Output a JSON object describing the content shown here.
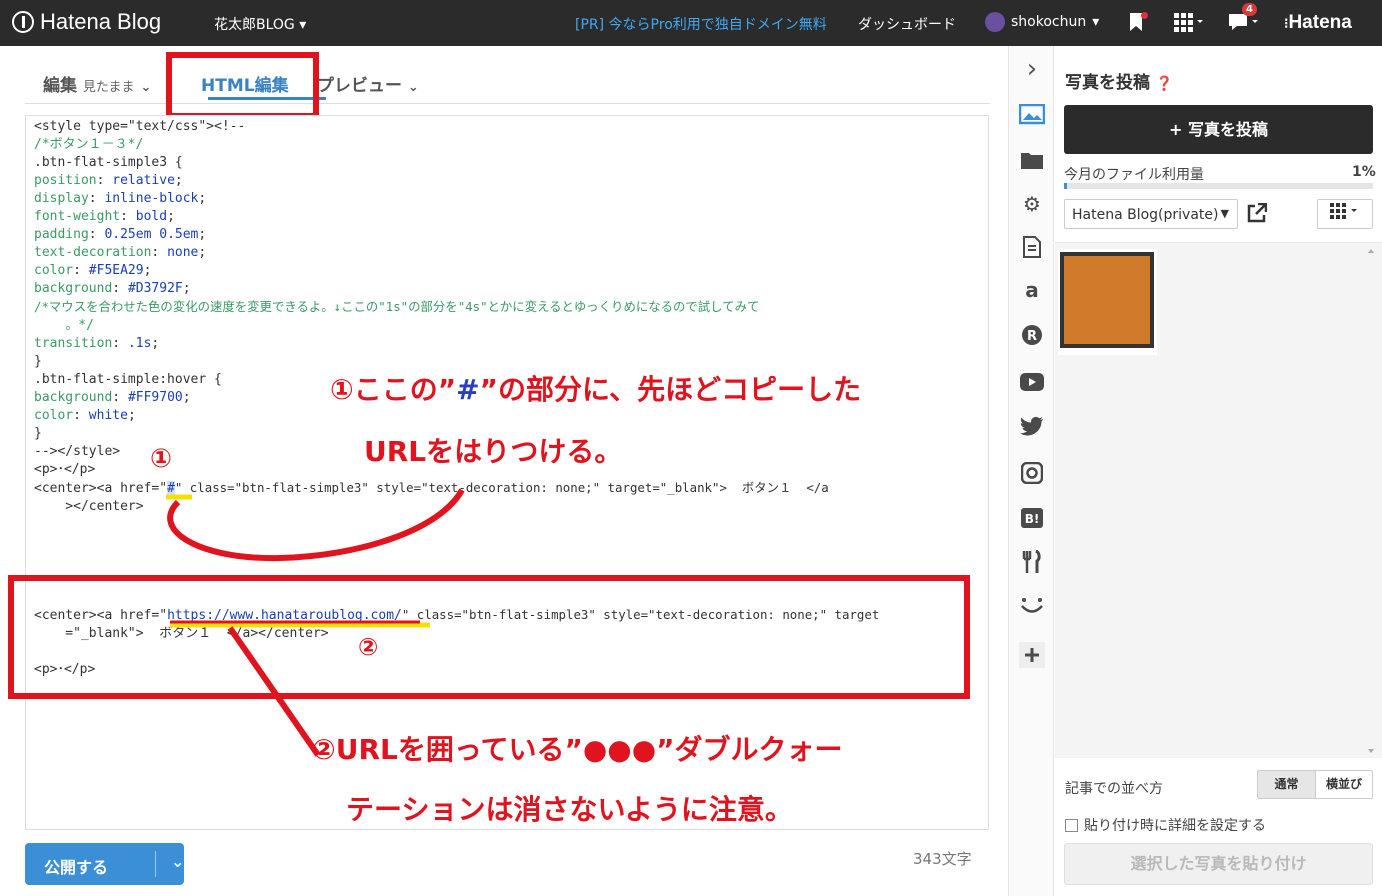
{
  "topbar": {
    "logo": "Hatena Blog",
    "blog_name": "花太郎BLOG",
    "promo": "[PR] 今ならPro利用で独自ドメイン無料",
    "dashboard": "ダッシュボード",
    "username": "shokochun",
    "notification_count": "4",
    "brand": "Hatena"
  },
  "tabs": {
    "edit_label": "編集",
    "edit_mode": "見たまま",
    "html_edit": "HTML編集",
    "preview": "プレビュー"
  },
  "code": {
    "l1": "<style type=\"text/css\"><!--",
    "l2": "/*ボタン１－３*/",
    "l3": ".btn-flat-simple3 {",
    "l4k": "position",
    "l4v": "relative",
    "l5k": "display",
    "l5v": "inline-block",
    "l6k": "font-weight",
    "l6v": "bold",
    "l7k": "padding",
    "l7v": "0.25em 0.5em",
    "l8k": "text-decoration",
    "l8v": "none",
    "l9k": "color",
    "l9v": "#F5EA29",
    "l10k": "background",
    "l10v": "#D3792F",
    "l11": "/*マウスを合わせた色の変化の速度を変更できるよ。↓ここの\"1s\"の部分を\"4s\"とかに変えるとゆっくりめになるので試してみて",
    "l12": "    。*/",
    "l13k": "transition",
    "l13v": ".1s",
    "l14": "}",
    "l15": ".btn-flat-simple:hover {",
    "l16k": "background",
    "l16v": "#FF9700",
    "l17k": "color",
    "l17v": "white",
    "l18": "}",
    "l19": "--></style>",
    "l20": "<p>･</p>",
    "l21a": "<center><a href=\"",
    "l21b": "#",
    "l21c": "\" class=\"btn-flat-simple3\" style=\"text-decoration: none;\" target=\"_blank\">  ボタン１  </a",
    "l22": "    ></center>",
    "l23a": "<center><a href=\"",
    "l23b": "https://www.hanataroublog.com/",
    "l23c": "\" class=\"btn-flat-simple3\" style=\"text-decoration: none;\" target",
    "l24": "    =\"_blank\">  ボタン１  </a></center>",
    "l25": "<p>･</p>"
  },
  "annotations": {
    "a1_num": "①",
    "a1_line1_pre": "①ここの”",
    "a1_line1_hash": "#",
    "a1_line1_post": "”の部分に、先ほどコピーした",
    "a1_line2": "URLをはりつける。",
    "a2_num": "②",
    "a2_line1": "②URLを囲っている”●●●”ダブルクォー",
    "a2_line2": "テーションは消さないように注意。"
  },
  "footer": {
    "publish": "公開する",
    "char_count": "343文字"
  },
  "panel": {
    "title": "写真を投稿",
    "post_button": "+ 写真を投稿",
    "usage_label": "今月のファイル利用量",
    "usage_pct": "1%",
    "usage_fraction": 0.01,
    "album": "Hatena Blog(private)",
    "sort_label": "記事での並べ方",
    "sort_normal": "通常",
    "sort_side": "横並び",
    "detail_checkbox": "貼り付け時に詳細を設定する",
    "paste_button": "選択した写真を貼り付け"
  },
  "colors": {
    "accent": "#3b8fd6",
    "annotation": "#e0141e",
    "thumb": "#d07a2c"
  }
}
